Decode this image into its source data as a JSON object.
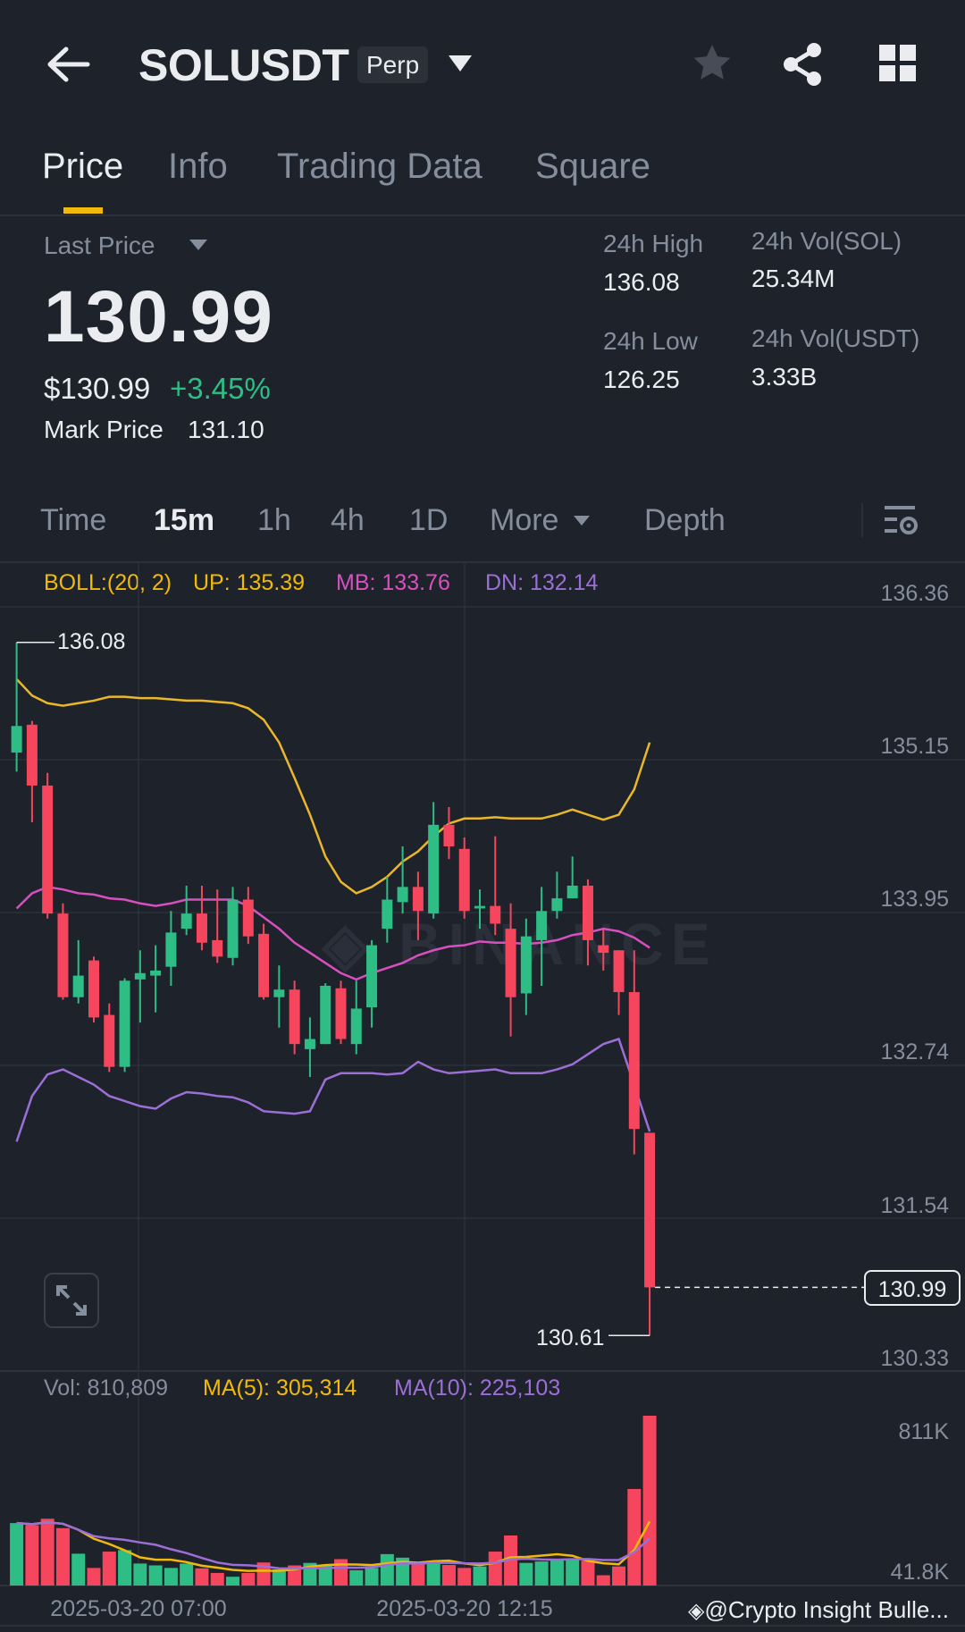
{
  "header": {
    "title": "SOLUSDT",
    "badge": "Perp"
  },
  "tabs": [
    {
      "label": "Price"
    },
    {
      "label": "Info"
    },
    {
      "label": "Trading Data"
    },
    {
      "label": "Square"
    }
  ],
  "price": {
    "last_price_label": "Last Price",
    "last_price": "130.99",
    "usd_price": "$130.99",
    "change": "+3.45%",
    "mark_price_label": "Mark Price",
    "mark_price": "131.10"
  },
  "stats": {
    "high_label": "24h High",
    "high": "136.08",
    "low_label": "24h Low",
    "low": "126.25",
    "vol_sol_label": "24h Vol(SOL)",
    "vol_sol": "25.34M",
    "vol_usdt_label": "24h Vol(USDT)",
    "vol_usdt": "3.33B"
  },
  "intervals": [
    {
      "label": "Time"
    },
    {
      "label": "15m"
    },
    {
      "label": "1h"
    },
    {
      "label": "4h"
    },
    {
      "label": "1D"
    },
    {
      "label": "More"
    },
    {
      "label": "Depth"
    }
  ],
  "boll": {
    "label": "BOLL:(20, 2)",
    "up": "UP: 135.39",
    "mb": "MB: 133.76",
    "dn": "DN: 132.14"
  },
  "volume_legend": {
    "vol": "Vol: 810,809",
    "ma5": "MA(5): 305,314",
    "ma10": "MA(10): 225,103"
  },
  "watermark": "BINANCE",
  "footer": {
    "credit": "@Crypto Insight Bulle..."
  },
  "colors": {
    "bg": "#1e222b",
    "up": "#2ebd85",
    "down": "#f6465d",
    "accent": "#f0b90b",
    "boll_up": "#e9b82a",
    "boll_mb": "#d84fbf",
    "boll_dn": "#9b6fd6",
    "ma5": "#f0b90b",
    "ma10": "#9b6fd6"
  },
  "chart_data": {
    "type": "candlestick",
    "y_ticks": [
      "136.36",
      "135.15",
      "133.95",
      "132.74",
      "131.54",
      "130.33"
    ],
    "ylim": [
      130.33,
      136.36
    ],
    "x_ticks": [
      "2025-03-20 07:00",
      "2025-03-20 12:15"
    ],
    "high_marker": "136.08",
    "low_marker": "130.61",
    "current_price": "130.99",
    "ohlc": [
      [
        135.21,
        136.08,
        135.06,
        135.42
      ],
      [
        135.43,
        135.46,
        134.66,
        134.95
      ],
      [
        134.95,
        135.05,
        133.9,
        133.94
      ],
      [
        133.94,
        134.02,
        133.26,
        133.28
      ],
      [
        133.28,
        133.73,
        133.23,
        133.45
      ],
      [
        133.57,
        133.6,
        133.08,
        133.12
      ],
      [
        133.14,
        133.23,
        132.69,
        132.73
      ],
      [
        132.73,
        133.43,
        132.69,
        133.41
      ],
      [
        133.42,
        133.65,
        133.08,
        133.47
      ],
      [
        133.45,
        133.69,
        133.16,
        133.49
      ],
      [
        133.52,
        133.96,
        133.37,
        133.79
      ],
      [
        133.82,
        134.16,
        133.77,
        133.94
      ],
      [
        133.94,
        134.16,
        133.65,
        133.71
      ],
      [
        133.73,
        134.13,
        133.55,
        133.6
      ],
      [
        133.59,
        134.15,
        133.53,
        134.05
      ],
      [
        134.05,
        134.15,
        133.7,
        133.76
      ],
      [
        133.78,
        133.86,
        133.26,
        133.28
      ],
      [
        133.28,
        133.53,
        133.04,
        133.34
      ],
      [
        133.34,
        133.41,
        132.83,
        132.91
      ],
      [
        132.87,
        133.12,
        132.65,
        132.95
      ],
      [
        132.91,
        133.39,
        132.91,
        133.37
      ],
      [
        133.35,
        133.41,
        132.91,
        132.95
      ],
      [
        132.91,
        133.41,
        132.83,
        133.19
      ],
      [
        133.2,
        133.73,
        133.04,
        133.69
      ],
      [
        133.82,
        134.23,
        133.71,
        134.05
      ],
      [
        134.03,
        134.47,
        133.94,
        134.15
      ],
      [
        134.15,
        134.27,
        133.73,
        133.96
      ],
      [
        133.94,
        134.82,
        133.9,
        134.64
      ],
      [
        134.64,
        134.78,
        134.37,
        134.47
      ],
      [
        134.45,
        134.54,
        133.9,
        133.96
      ],
      [
        133.98,
        134.13,
        133.82,
        134.0
      ],
      [
        134.0,
        134.55,
        133.77,
        133.86
      ],
      [
        133.82,
        134.02,
        132.97,
        133.28
      ],
      [
        133.31,
        133.9,
        133.14,
        133.76
      ],
      [
        133.73,
        134.15,
        133.37,
        133.96
      ],
      [
        133.96,
        134.27,
        133.9,
        134.06
      ],
      [
        134.06,
        134.39,
        134.06,
        134.16
      ],
      [
        134.16,
        134.21,
        133.53,
        133.73
      ],
      [
        133.69,
        133.81,
        133.49,
        133.63
      ],
      [
        133.65,
        133.65,
        133.14,
        133.32
      ],
      [
        133.32,
        133.65,
        132.04,
        132.24
      ],
      [
        132.21,
        132.21,
        130.61,
        130.99
      ]
    ],
    "boll_up": [
      135.79,
      135.66,
      135.6,
      135.58,
      135.6,
      135.62,
      135.65,
      135.65,
      135.64,
      135.64,
      135.63,
      135.62,
      135.62,
      135.61,
      135.6,
      135.56,
      135.47,
      135.29,
      135.01,
      134.72,
      134.39,
      134.19,
      134.1,
      134.15,
      134.23,
      134.35,
      134.43,
      134.55,
      134.65,
      134.69,
      134.69,
      134.7,
      134.69,
      134.69,
      134.69,
      134.72,
      134.76,
      134.72,
      134.68,
      134.72,
      134.92,
      135.29
    ],
    "boll_mb": [
      133.98,
      134.1,
      134.15,
      134.13,
      134.1,
      134.09,
      134.06,
      134.05,
      134.02,
      134.0,
      134.02,
      134.05,
      134.05,
      134.05,
      134.05,
      134.0,
      133.91,
      133.82,
      133.71,
      133.63,
      133.55,
      133.47,
      133.42,
      133.47,
      133.51,
      133.55,
      133.61,
      133.65,
      133.68,
      133.69,
      133.72,
      133.71,
      133.71,
      133.7,
      133.71,
      133.73,
      133.77,
      133.79,
      133.82,
      133.8,
      133.75,
      133.67
    ],
    "boll_dn": [
      132.14,
      132.5,
      132.67,
      132.71,
      132.65,
      132.59,
      132.5,
      132.46,
      132.42,
      132.4,
      132.48,
      132.53,
      132.52,
      132.5,
      132.49,
      132.45,
      132.38,
      132.37,
      132.36,
      132.38,
      132.63,
      132.68,
      132.68,
      132.68,
      132.67,
      132.68,
      132.77,
      132.71,
      132.68,
      132.69,
      132.7,
      132.71,
      132.68,
      132.68,
      132.68,
      132.71,
      132.75,
      132.83,
      132.91,
      132.95,
      132.59,
      132.22
    ],
    "volume_ticks": [
      "811K",
      "41.8K"
    ],
    "volume": [
      298000,
      288000,
      319000,
      274000,
      152000,
      84000,
      162000,
      169000,
      105000,
      96000,
      84000,
      105000,
      82000,
      60000,
      42000,
      60000,
      110000,
      77000,
      96000,
      108000,
      98000,
      126000,
      73000,
      84000,
      150000,
      133000,
      105000,
      108000,
      98000,
      84000,
      91000,
      162000,
      239000,
      108000,
      115000,
      122000,
      126000,
      119000,
      49000,
      91000,
      461000,
      810809
    ]
  }
}
